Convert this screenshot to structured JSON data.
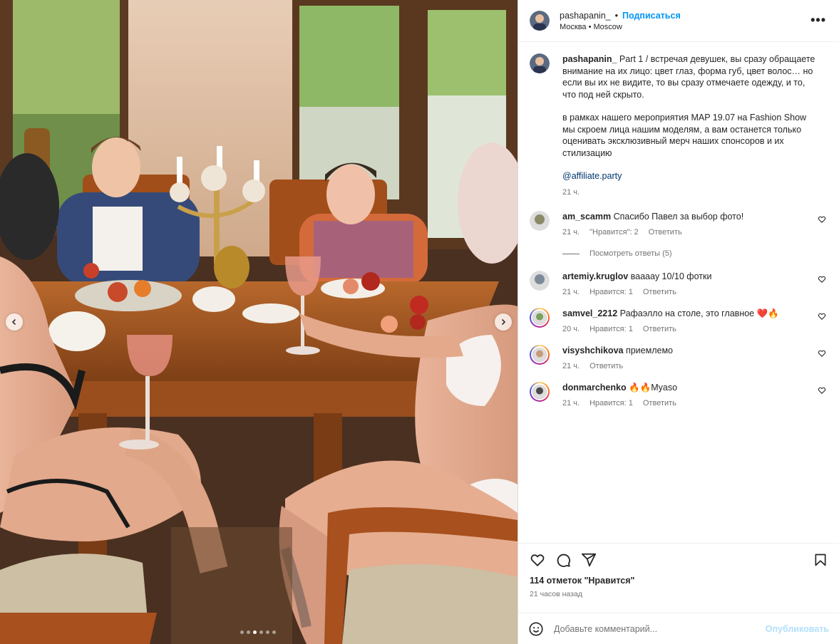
{
  "post": {
    "author": "pashapanin_",
    "follow_label": "Подписаться",
    "separator": "•",
    "location": "Москва • Moscow",
    "more_label": "•••"
  },
  "caption": {
    "username": "pashapanin_",
    "paragraph1": "Part 1 / встречая девушек, вы сразу обращаете внимание на их лицо: цвет глаз, форма губ, цвет волос… но если вы их не видите, то вы сразу отмечаете одежду, и то, что под ней скрыто.",
    "paragraph2": "в рамках нашего мероприятия MAP 19.07 на Fashion Show мы скроем лица нашим моделям, а вам останется только оценивать эксклюзивный мерч наших спонсоров и их стилизацию",
    "tag": "@affiliate.party",
    "time": "21 ч."
  },
  "comments": [
    {
      "username": "am_scamm",
      "text": "Спасибо Павел за выбор фото!",
      "time": "21 ч.",
      "likes": "\"Нравится\": 2",
      "reply": "Ответить",
      "avatar_color": "#8a8a6a"
    },
    {
      "username": "artemiy.kruglov",
      "text": "ваааау 10/10 фотки",
      "time": "21 ч.",
      "likes": "Нравится: 1",
      "reply": "Ответить",
      "avatar_color": "#7d8a9a"
    },
    {
      "username": "samvel_2212",
      "text": "Рафаэлло на столе, это главное ❤️🔥",
      "time": "20 ч.",
      "likes": "Нравится: 1",
      "reply": "Ответить",
      "avatar_color": "#7aa05a"
    },
    {
      "username": "visyshchikova",
      "text": "приемлемо",
      "time": "21 ч.",
      "likes": "",
      "reply": "Ответить",
      "avatar_color": "#c99a7a"
    },
    {
      "username": "donmarchenko",
      "text": "🔥🔥Myaso",
      "time": "21 ч.",
      "likes": "Нравится: 1",
      "reply": "Ответить",
      "avatar_color": "#4a4a4a"
    }
  ],
  "view_replies": "Посмотреть ответы (5)",
  "actions": {
    "likes_count": "114 отметок \"Нравится\"",
    "posted_ago": "21 часов назад"
  },
  "add_comment": {
    "placeholder": "Добавьте комментарий...",
    "publish_label": "Опубликовать"
  },
  "carousel": {
    "total": 6,
    "active": 2
  },
  "colors": {
    "accent": "#0095f6",
    "link": "#00376b",
    "muted": "#737373",
    "publish_disabled": "#b2dffc"
  }
}
